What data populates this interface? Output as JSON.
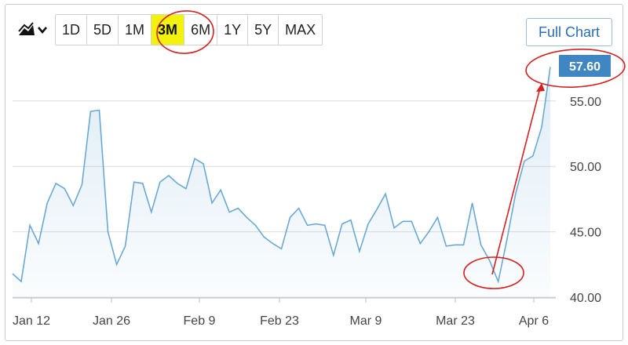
{
  "toolbar": {
    "chart_type_icon": "area-chart-icon",
    "dropdown_icon": "chevron-down-icon",
    "ranges": [
      "1D",
      "5D",
      "1M",
      "3M",
      "6M",
      "1Y",
      "5Y",
      "MAX"
    ],
    "active_range": "3M",
    "full_chart_label": "Full Chart"
  },
  "colors": {
    "line": "#6aa9d4",
    "fill": "#e8f2fa",
    "last_badge": "#3f86c3",
    "annotation": "#d42020",
    "active_range_bg": "#f2f20d"
  },
  "chart_data": {
    "type": "area",
    "title": "",
    "xlabel": "",
    "ylabel": "",
    "ylim": [
      40,
      60
    ],
    "grid": true,
    "y_ticks": [
      "40.00",
      "45.00",
      "50.00",
      "55.00"
    ],
    "x_ticks": [
      "Jan 12",
      "Jan 26",
      "Feb 9",
      "Feb 23",
      "Mar 9",
      "Mar 23",
      "Apr 6"
    ],
    "last_value_label": "57.60",
    "series": [
      {
        "values": [
          41.8,
          41.2,
          45.5,
          44.1,
          47.2,
          48.7,
          48.3,
          47.0,
          48.6,
          54.2,
          54.3,
          45.0,
          42.5,
          43.9,
          48.8,
          48.7,
          46.5,
          48.8,
          49.3,
          48.7,
          48.3,
          50.6,
          50.2,
          47.2,
          48.2,
          46.5,
          46.8,
          46.1,
          45.5,
          44.6,
          44.1,
          43.7,
          46.1,
          46.8,
          45.5,
          45.6,
          45.5,
          43.2,
          45.6,
          45.9,
          43.5,
          45.6,
          46.7,
          47.9,
          45.3,
          45.8,
          45.8,
          44.1,
          45.0,
          46.1,
          43.9,
          44.0,
          44.0,
          47.2,
          44.0,
          42.8,
          41.2,
          44.4,
          47.9,
          50.4,
          50.8,
          53.0,
          57.6
        ]
      }
    ],
    "annotations": [
      {
        "type": "circle",
        "target": "active-range-3M"
      },
      {
        "type": "circle",
        "target": "low-point"
      },
      {
        "type": "circle",
        "target": "last-value-label"
      },
      {
        "type": "arrow",
        "from": "low-point",
        "to": "last-value-label"
      }
    ]
  }
}
